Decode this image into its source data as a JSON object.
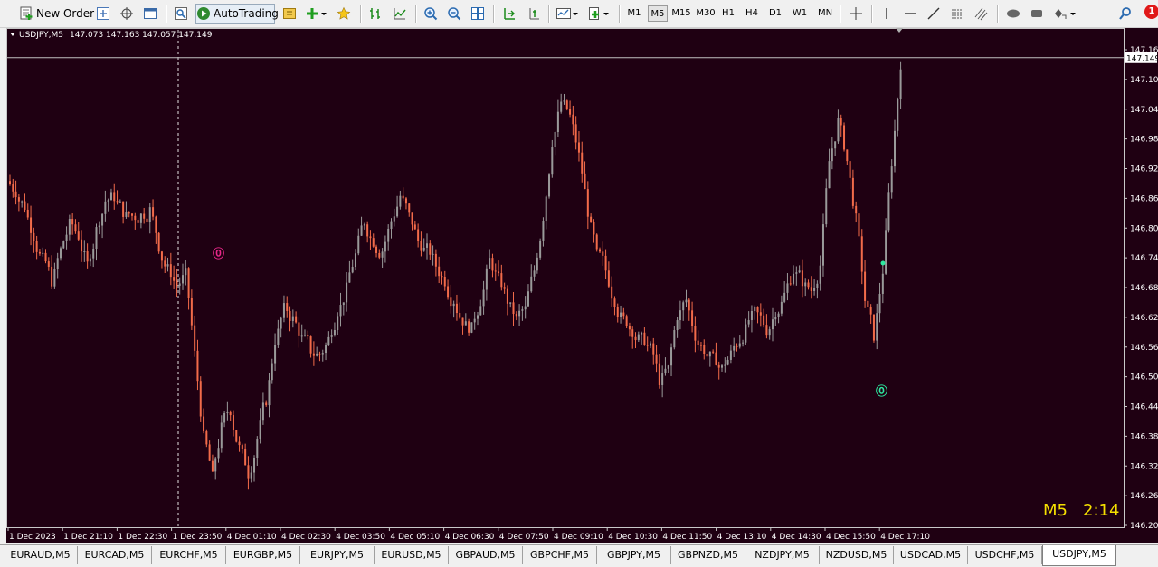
{
  "toolbar": {
    "new_order_label": "New Order",
    "autotrading_label": "AutoTrading",
    "timeframes": [
      "M1",
      "M5",
      "M15",
      "M30",
      "H1",
      "H4",
      "D1",
      "W1",
      "MN"
    ],
    "active_timeframe": "M5",
    "notification_count": "1"
  },
  "chart": {
    "symbol_header": "USDJPY,M5",
    "ohlc": "147.073 147.163 147.057 147.149",
    "current_price": "147.149",
    "timer_timeframe": "M5",
    "timer_value": "2:14",
    "background": "#1f0012",
    "bull_color": "#9a9a9a",
    "bear_color": "#f26b4a",
    "up_arrow_color": "#2ee8a0",
    "down_arrow_color": "#e8288a",
    "price_labels": [
      "147.165",
      "147.105",
      "147.045",
      "146.985",
      "146.925",
      "146.865",
      "146.805",
      "146.745",
      "146.685",
      "146.625",
      "146.565",
      "146.505",
      "146.445",
      "146.385",
      "146.325",
      "146.265",
      "146.205"
    ],
    "time_labels": [
      "1 Dec 2023",
      "1 Dec 21:10",
      "1 Dec 22:30",
      "1 Dec 23:50",
      "4 Dec 01:10",
      "4 Dec 02:30",
      "4 Dec 03:50",
      "4 Dec 05:10",
      "4 Dec 06:30",
      "4 Dec 07:50",
      "4 Dec 09:10",
      "4 Dec 10:30",
      "4 Dec 11:50",
      "4 Dec 13:10",
      "4 Dec 14:30",
      "4 Dec 15:50",
      "4 Dec 17:10"
    ]
  },
  "tabs": [
    "EURAUD,M5",
    "EURCAD,M5",
    "EURCHF,M5",
    "EURGBP,M5",
    "EURJPY,M5",
    "EURUSD,M5",
    "GBPAUD,M5",
    "GBPCHF,M5",
    "GBPJPY,M5",
    "GBPNZD,M5",
    "NZDJPY,M5",
    "NZDUSD,M5",
    "USDCAD,M5",
    "USDCHF,M5",
    "USDJPY,M5"
  ],
  "active_tab": "USDJPY,M5",
  "chart_data": {
    "type": "line",
    "x_labels": [
      "1 Dec 2023",
      "1 Dec 21:10",
      "1 Dec 22:30",
      "1 Dec 23:50",
      "4 Dec 01:10",
      "4 Dec 02:30",
      "4 Dec 03:50",
      "4 Dec 05:10",
      "4 Dec 06:30",
      "4 Dec 07:50",
      "4 Dec 09:10",
      "4 Dec 10:30",
      "4 Dec 11:50",
      "4 Dec 13:10",
      "4 Dec 14:30",
      "4 Dec 15:50",
      "4 Dec 17:10"
    ],
    "ylim": [
      146.205,
      147.165
    ],
    "series": [
      {
        "values": [
          146.88,
          146.85,
          146.79,
          146.74,
          146.7,
          146.76,
          146.81,
          146.79,
          146.73,
          146.8,
          146.86,
          146.87,
          146.84,
          146.83,
          146.83,
          146.84,
          146.77,
          146.72,
          146.69,
          146.71,
          146.55,
          146.38,
          146.3,
          146.4,
          146.44,
          146.36,
          146.31,
          146.38,
          146.46,
          146.58,
          146.64,
          146.62,
          146.58,
          146.56,
          146.55,
          146.58,
          146.64,
          146.68,
          146.75,
          146.82,
          146.78,
          146.76,
          146.82,
          146.87,
          146.83,
          146.78,
          146.76,
          146.73,
          146.7,
          146.66,
          146.62,
          146.6,
          146.66,
          146.74,
          146.7,
          146.66,
          146.62,
          146.64,
          146.72,
          146.83,
          146.98,
          147.06,
          147.03,
          146.95,
          146.84,
          146.75,
          146.72,
          146.66,
          146.62,
          146.6,
          146.58,
          146.56,
          146.5,
          146.52,
          146.63,
          146.66,
          146.59,
          146.56,
          146.54,
          146.52,
          146.55,
          146.58,
          146.62,
          146.63,
          146.6,
          146.64,
          146.67,
          146.72,
          146.7,
          146.68,
          146.73,
          146.94,
          147.02,
          146.94,
          146.82,
          146.66,
          146.59,
          146.72,
          146.94,
          147.14
        ]
      }
    ]
  }
}
